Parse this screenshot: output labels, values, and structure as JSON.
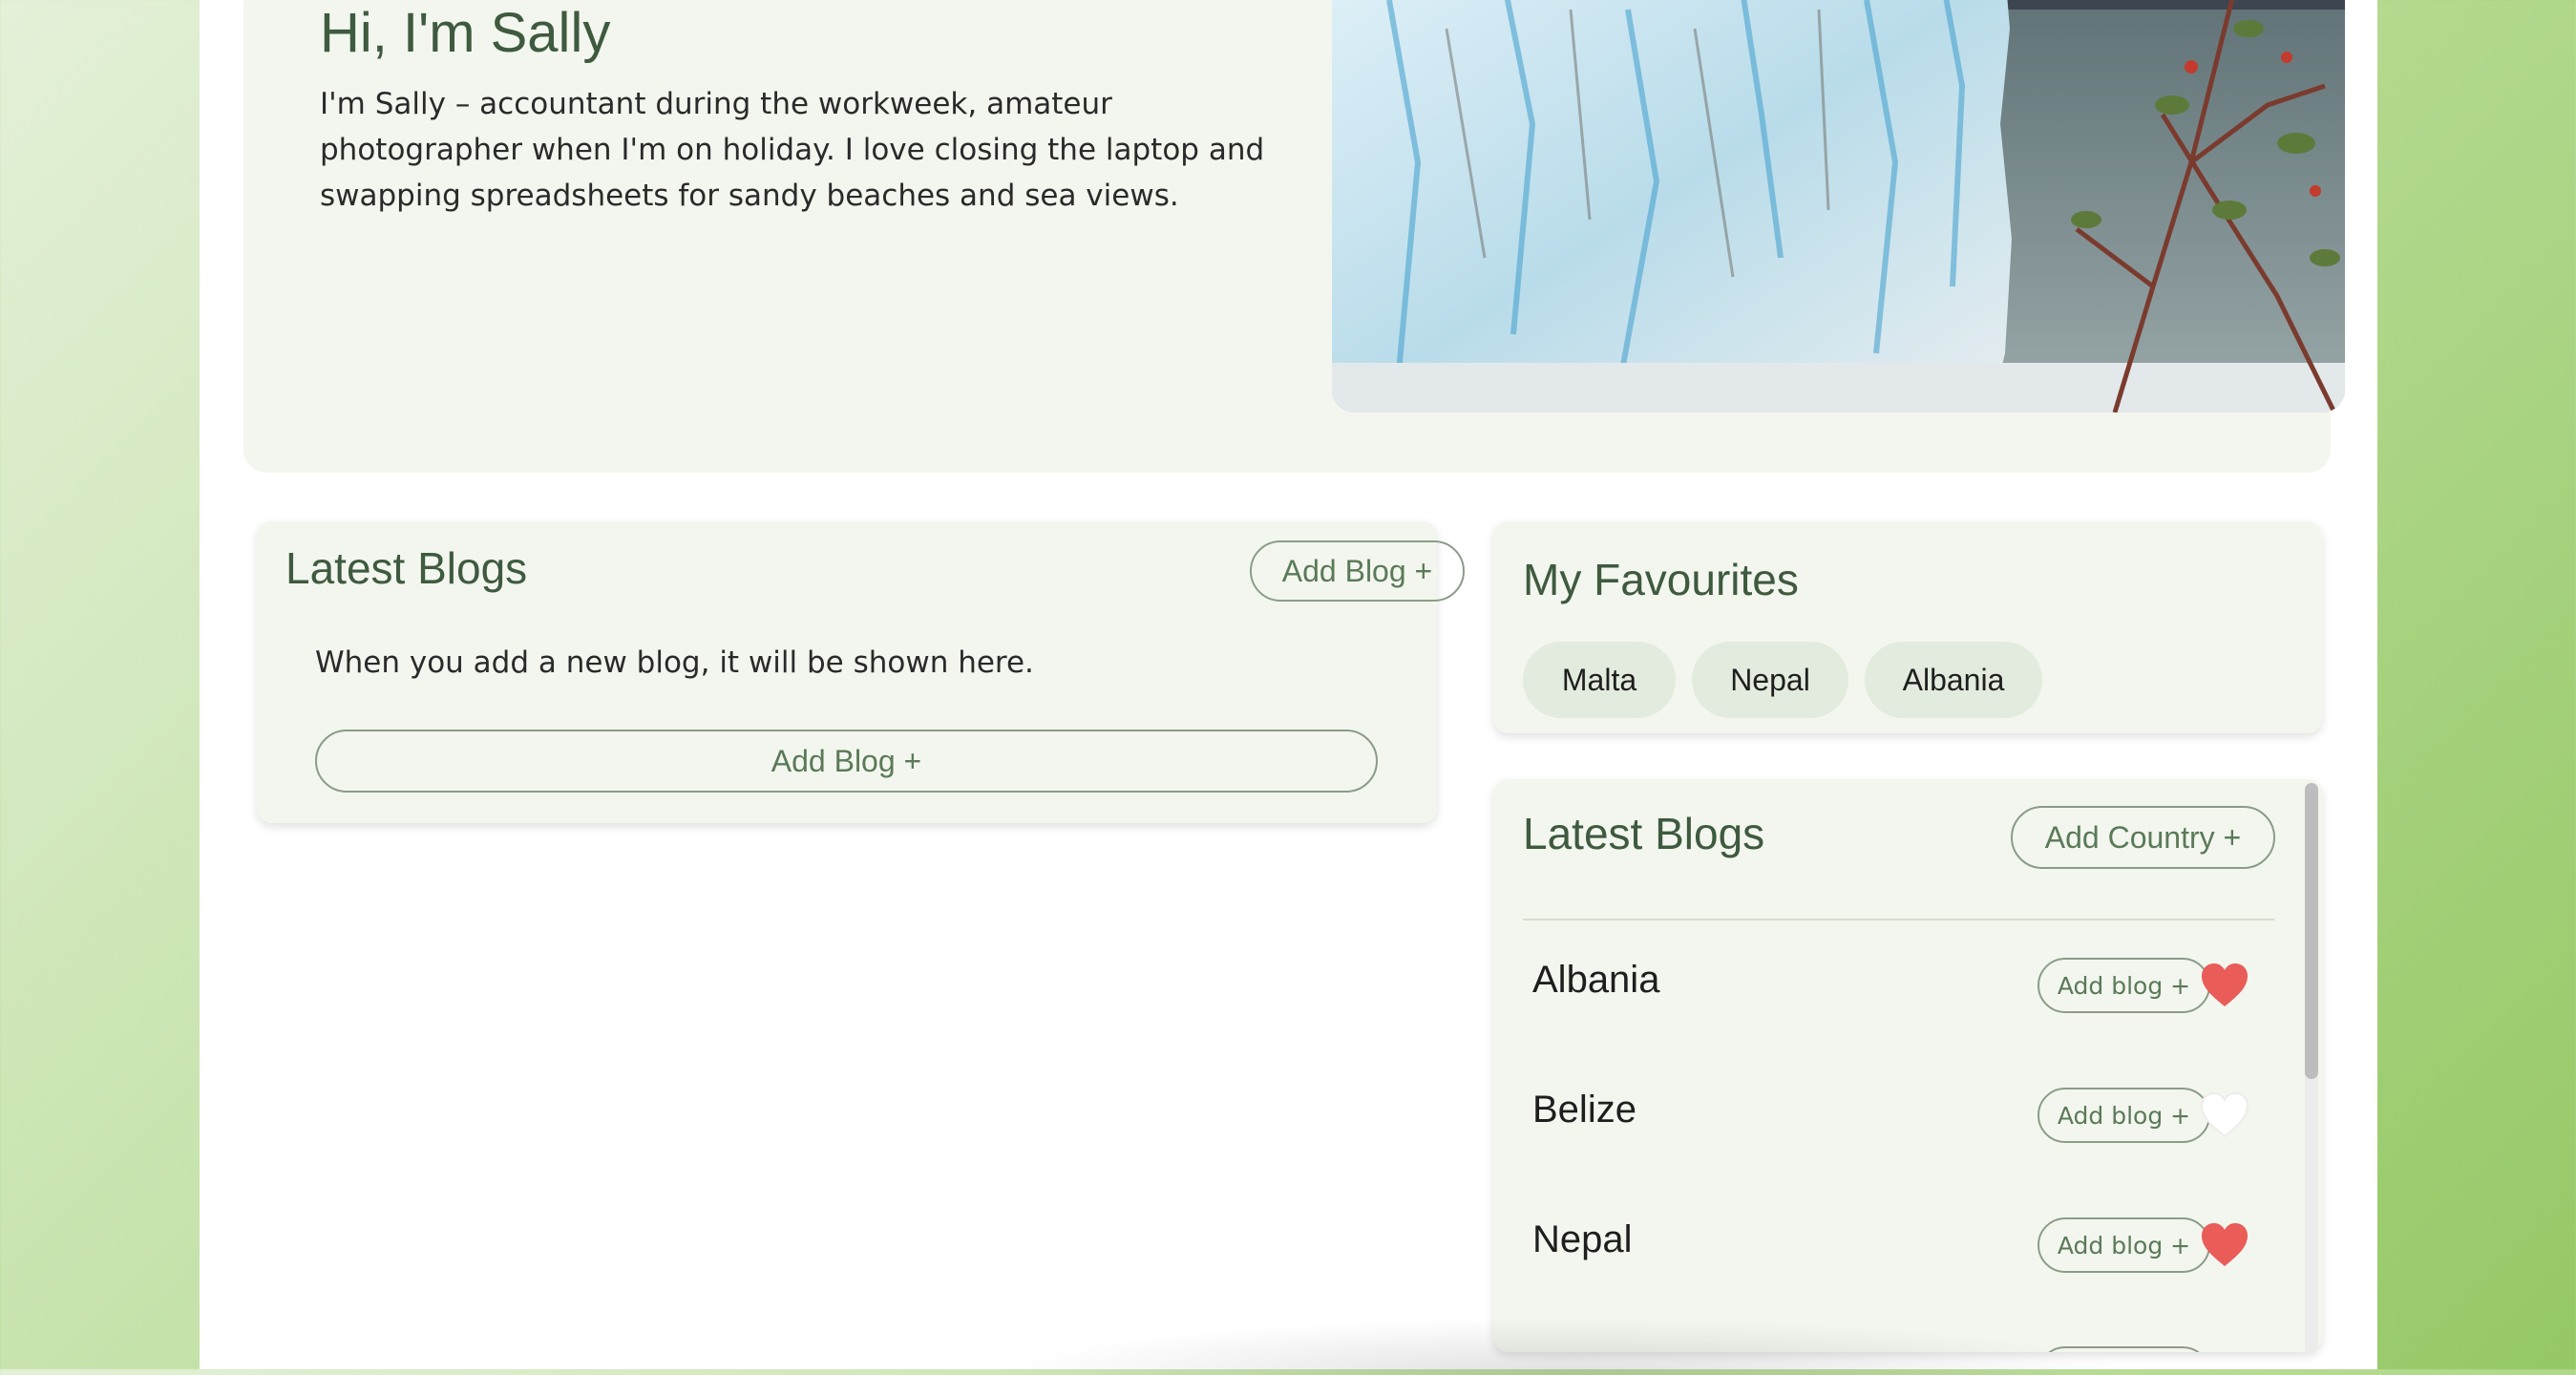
{
  "hero": {
    "title": "Hi, I'm Sally",
    "description": "I'm Sally – accountant during the workweek, amateur photographer when I'm on holiday. I love closing the laptop and swapping spreadsheets for sandy beaches and sea views."
  },
  "blogs_panel": {
    "title": "Latest Blogs",
    "add_button_label": "Add Blog +",
    "empty_message": "When you add a new blog, it will be shown here.",
    "add_button_wide_label": "Add Blog +"
  },
  "favourites_panel": {
    "title": "My Favourites",
    "chips": [
      "Malta",
      "Nepal",
      "Albania"
    ]
  },
  "countries_panel": {
    "title": "Latest Blogs",
    "add_button_label": "Add Country +",
    "rows": [
      {
        "name": "Albania",
        "add_label": "Add blog +",
        "favourite": true
      },
      {
        "name": "Belize",
        "add_label": "Add blog +",
        "favourite": false
      },
      {
        "name": "Nepal",
        "add_label": "Add blog +",
        "favourite": true
      }
    ]
  },
  "colors": {
    "accent_green": "#3e5a3f",
    "heart_active": "#e95c58",
    "heart_inactive": "#ffffff"
  }
}
